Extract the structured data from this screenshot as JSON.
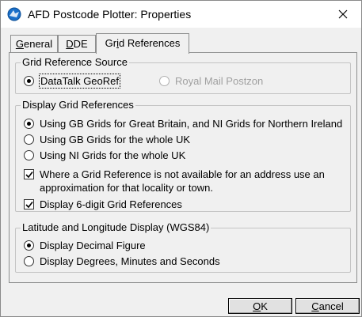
{
  "window": {
    "title": "AFD Postcode Plotter: Properties",
    "icon": "afd-globe-icon",
    "accent_color": "#1a6fc9"
  },
  "tabs": [
    {
      "label_pre": "",
      "label_u": "G",
      "label_post": "eneral",
      "active": false
    },
    {
      "label_pre": "",
      "label_u": "D",
      "label_post": "DE",
      "active": false
    },
    {
      "label_pre": "Gr",
      "label_u": "i",
      "label_post": "d References",
      "active": true
    }
  ],
  "source_group": {
    "label": "Grid Reference Source",
    "options": [
      {
        "label": "DataTalk GeoRef",
        "checked": true,
        "enabled": true
      },
      {
        "label": "Royal Mail Postzon",
        "checked": false,
        "enabled": false
      }
    ]
  },
  "display_group": {
    "label": "Display Grid References",
    "radios": [
      {
        "label": "Using GB Grids for Great Britain, and NI Grids for Northern Ireland",
        "checked": true
      },
      {
        "label": "Using GB Grids for the whole UK",
        "checked": false
      },
      {
        "label": "Using NI Grids for the whole UK",
        "checked": false
      }
    ],
    "checkboxes": [
      {
        "label_line1": "Where a Grid Reference is not available for an address use an",
        "label_line2": "approximation for that locality or town.",
        "checked": true
      },
      {
        "label": "Display 6-digit Grid References",
        "checked": true
      }
    ]
  },
  "latlong_group": {
    "label": "Latitude and Longitude Display (WGS84)",
    "options": [
      {
        "label": "Display Decimal Figure",
        "checked": true
      },
      {
        "label": "Display Degrees, Minutes and Seconds",
        "checked": false
      }
    ]
  },
  "buttons": {
    "ok": {
      "u": "O",
      "rest": "K"
    },
    "cancel": {
      "u": "C",
      "rest": "ancel"
    }
  }
}
